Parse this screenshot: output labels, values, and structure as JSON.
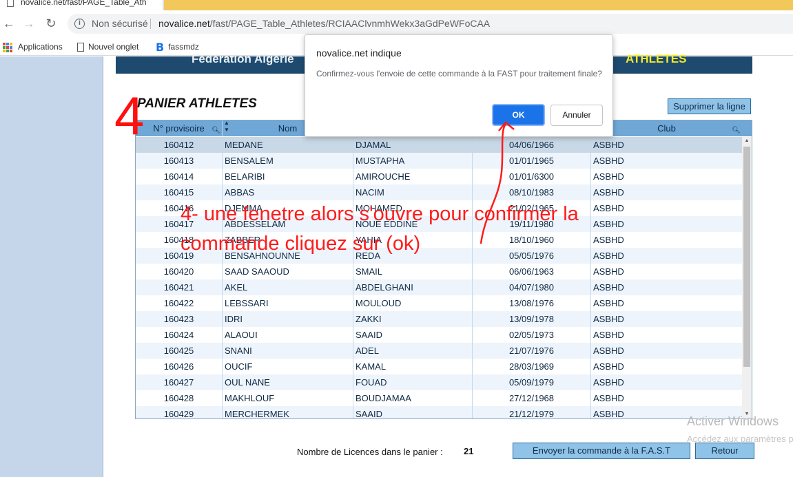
{
  "browser": {
    "tab_title": "novalice.net/fast/PAGE_Table_Ath",
    "security_label": "Non sécurisé",
    "url_host": "novalice.net",
    "url_path": "/fast/PAGE_Table_Athletes/RCIAAClvnmhWekx3aGdPeWFoCAA",
    "bookmarks": [
      {
        "label": "Applications",
        "icon": "apps-grid-icon"
      },
      {
        "label": "Nouvel onglet",
        "icon": "page-icon"
      },
      {
        "label": "fassmdz",
        "icon": "b-logo-icon"
      }
    ]
  },
  "banner": {
    "federation": "Fédération Algérie",
    "athletes": "ATHLETES"
  },
  "page": {
    "title": "PANIER ATHLETES",
    "delete_button": "Supprimer la ligne"
  },
  "table": {
    "columns": [
      "N° provisoire",
      "Nom",
      "",
      "",
      "Club"
    ],
    "rows": [
      {
        "num": "160412",
        "nom": "MEDANE",
        "prenom": "DJAMAL",
        "date": "04/06/1966",
        "club": "ASBHD"
      },
      {
        "num": "160413",
        "nom": "BENSALEM",
        "prenom": "MUSTAPHA",
        "date": "01/01/1965",
        "club": "ASBHD"
      },
      {
        "num": "160414",
        "nom": "BELARIBI",
        "prenom": "AMIROUCHE",
        "date": "01/01/6300",
        "club": "ASBHD"
      },
      {
        "num": "160415",
        "nom": "ABBAS",
        "prenom": "NACIM",
        "date": "08/10/1983",
        "club": "ASBHD"
      },
      {
        "num": "160416",
        "nom": "DJEMMA",
        "prenom": "MOHAMED",
        "date": "21/02/1965",
        "club": "ASBHD"
      },
      {
        "num": "160417",
        "nom": "ABDESSELAM",
        "prenom": "NOUE EDDINE",
        "date": "19/11/1980",
        "club": "ASBHD"
      },
      {
        "num": "160418",
        "nom": "ZABBER",
        "prenom": "YAHIA",
        "date": "18/10/1960",
        "club": "ASBHD"
      },
      {
        "num": "160419",
        "nom": "BENSAHNOUNNE",
        "prenom": "REDA",
        "date": "05/05/1976",
        "club": "ASBHD"
      },
      {
        "num": "160420",
        "nom": "SAAD SAAOUD",
        "prenom": "SMAIL",
        "date": "06/06/1963",
        "club": "ASBHD"
      },
      {
        "num": "160421",
        "nom": "AKEL",
        "prenom": "ABDELGHANI",
        "date": "04/07/1980",
        "club": "ASBHD"
      },
      {
        "num": "160422",
        "nom": "LEBSSARI",
        "prenom": "MOULOUD",
        "date": "13/08/1976",
        "club": "ASBHD"
      },
      {
        "num": "160423",
        "nom": "IDRI",
        "prenom": "ZAKKI",
        "date": "13/09/1978",
        "club": "ASBHD"
      },
      {
        "num": "160424",
        "nom": "ALAOUI",
        "prenom": "SAAID",
        "date": "02/05/1973",
        "club": "ASBHD"
      },
      {
        "num": "160425",
        "nom": "SNANI",
        "prenom": "ADEL",
        "date": "21/07/1976",
        "club": "ASBHD"
      },
      {
        "num": "160426",
        "nom": "OUCIF",
        "prenom": "KAMAL",
        "date": "28/03/1969",
        "club": "ASBHD"
      },
      {
        "num": "160427",
        "nom": "OUL NANE",
        "prenom": "FOUAD",
        "date": "05/09/1979",
        "club": "ASBHD"
      },
      {
        "num": "160428",
        "nom": "MAKHLOUF",
        "prenom": "BOUDJAMAA",
        "date": "27/12/1968",
        "club": "ASBHD"
      },
      {
        "num": "160429",
        "nom": "MERCHERMEK",
        "prenom": "SAAID",
        "date": "21/12/1979",
        "club": "ASBHD"
      }
    ]
  },
  "footer": {
    "count_label": "Nombre de  Licences dans le panier :",
    "count_value": "21",
    "send_button": "Envoyer la commande à la F.A.S.T",
    "back_button": "Retour"
  },
  "dialog": {
    "title": "novalice.net indique",
    "message": "Confirmez-vous l'envoie de cette commande à la FAST pour traitement finale?",
    "ok_label": "OK",
    "cancel_label": "Annuler"
  },
  "watermark": {
    "line1": "Activer Windows",
    "line2": "Accédez aux paramètres pour activer Windows."
  },
  "annotation": {
    "step_number": "4",
    "text": "4- une fenetre alors s'ouvre pour confirmer la commande cliquez sur (ok)",
    "color": "#ff1b1b"
  }
}
